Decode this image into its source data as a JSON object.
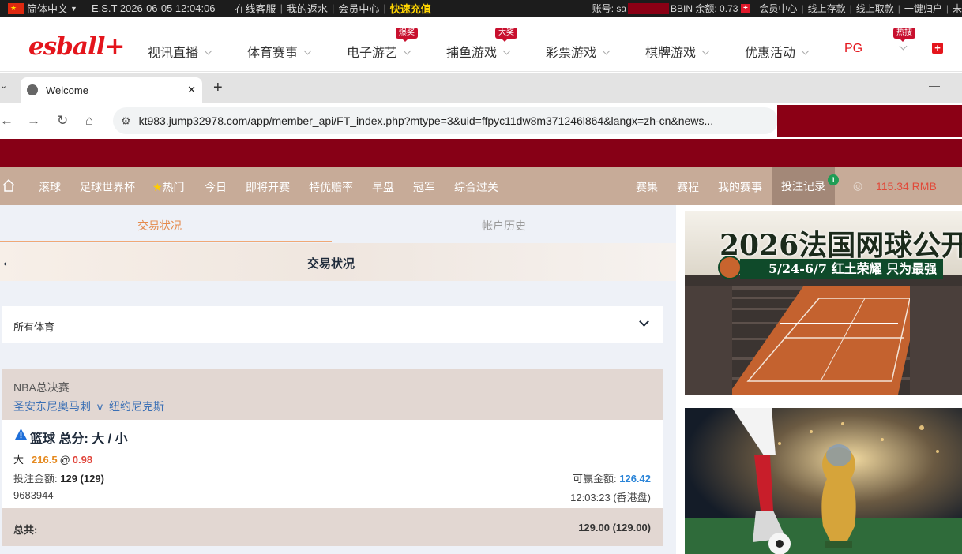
{
  "topbar": {
    "language": "简体中文",
    "time": "E.S.T 2026-06-05 12:04:06",
    "links": [
      "在线客服",
      "我的返水",
      "会员中心"
    ],
    "recharge": "快速充值",
    "account_label": "账号: sa",
    "bbin_label": "BBIN 余额: 0.73",
    "right_links": [
      "会员中心",
      "线上存款",
      "线上取款",
      "一键归户",
      "未"
    ]
  },
  "brand": {
    "logo": "esball+"
  },
  "mainnav": {
    "items": [
      {
        "label": "视讯直播"
      },
      {
        "label": "体育赛事"
      },
      {
        "label": "电子游艺",
        "badge": "爆奖"
      },
      {
        "label": "捕鱼游戏",
        "badge": "大奖"
      },
      {
        "label": "彩票游戏"
      },
      {
        "label": "棋牌游戏"
      },
      {
        "label": "优惠活动"
      },
      {
        "label": "PG"
      }
    ],
    "extra_badge": "热搜"
  },
  "browser": {
    "tab_title": "Welcome",
    "url": "kt983.jump32978.com/app/member_api/FT_index.php?mtype=3&uid=ffpyc11dw8m371246l864&langx=zh-cn&news..."
  },
  "sportsnav": {
    "left": [
      "滚球",
      "足球世界杯",
      "热门",
      "今日",
      "即将开赛",
      "特优赔率",
      "早盘",
      "冠军",
      "综合过关"
    ],
    "right": [
      "赛果",
      "赛程",
      "我的赛事",
      "投注记录"
    ],
    "notification_count": "1",
    "balance": "115.34  RMB"
  },
  "subtabs": [
    "交易状况",
    "帐户历史"
  ],
  "page_title": "交易状况",
  "filter": {
    "label": "所有体育"
  },
  "bet": {
    "league": "NBA总决赛",
    "home": "圣安东尼奥马刺",
    "vs": "v",
    "away": "纽约尼克斯",
    "type": "篮球 总分: 大 / 小",
    "pick": "大",
    "line": "216.5",
    "at": "@",
    "odds": "0.98",
    "stake_label": "投注金额:",
    "stake_value": "129 (129)",
    "win_label": "可赢金额:",
    "win_value": "126.42",
    "ticket_id": "9683944",
    "time": "12:03:23 (香港盘)",
    "total_label": "总共:",
    "total_value": "129.00 (129.00)"
  },
  "banners": {
    "french_open_title": "2026法国网球公开",
    "french_open_sub": "5/24-6/7 红土荣耀 只为最强"
  },
  "colors": {
    "topbar_bg": "#1c1c1c",
    "brand_red": "#e4151c",
    "maroon_band": "#870016",
    "sportsnav_bg": "#c7ab98",
    "active_tab_orange": "#e58a4c",
    "odds_red": "#e0443a",
    "line_orange": "#e58a20",
    "win_blue": "#2a84d8"
  }
}
